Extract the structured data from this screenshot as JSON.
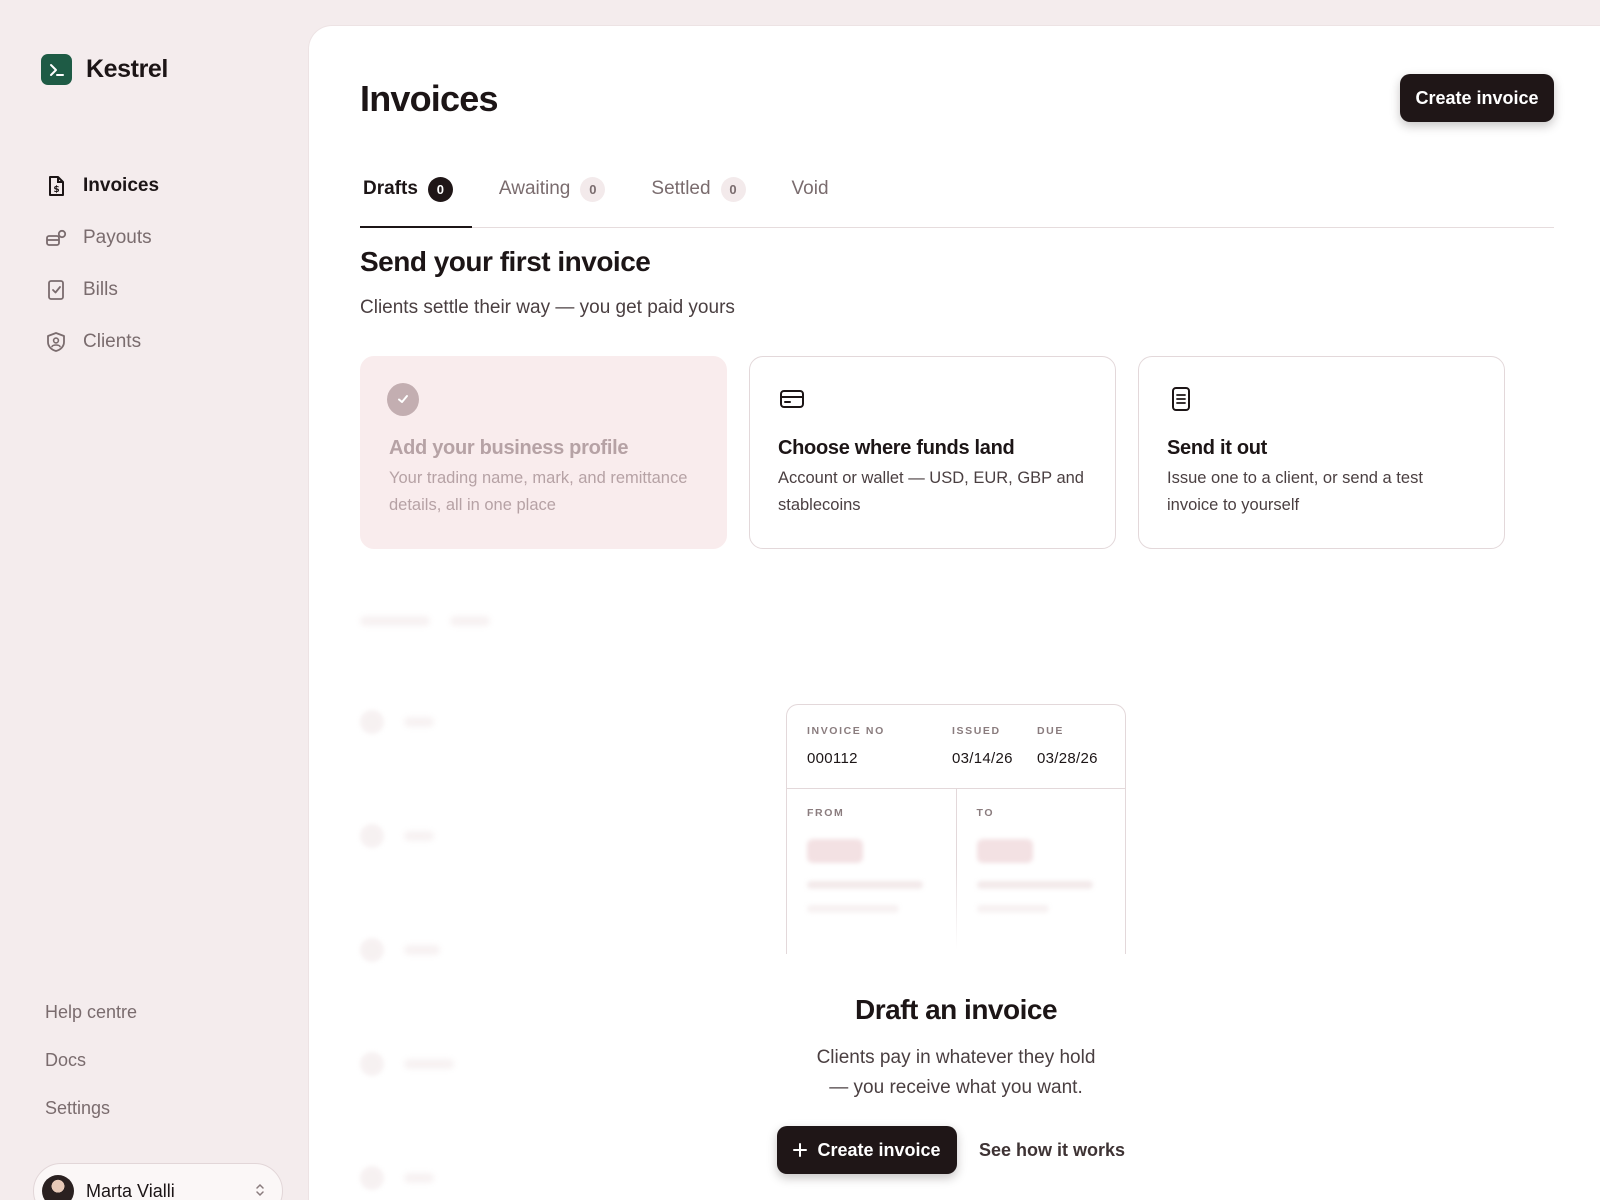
{
  "brand": {
    "name": "Kestrel",
    "logo_icon": "terminal-prompt-icon",
    "color": "#1e5b45"
  },
  "sidebar": {
    "items": [
      {
        "label": "Invoices",
        "icon": "invoice-doc-icon",
        "active": true
      },
      {
        "label": "Payouts",
        "icon": "payouts-icon",
        "active": false
      },
      {
        "label": "Bills",
        "icon": "bill-check-icon",
        "active": false
      },
      {
        "label": "Clients",
        "icon": "shield-user-icon",
        "active": false
      }
    ],
    "footer_links": [
      {
        "label": "Help centre"
      },
      {
        "label": "Docs"
      },
      {
        "label": "Settings"
      }
    ],
    "user": {
      "name": "Marta Vialli"
    }
  },
  "header": {
    "title": "Invoices",
    "create_label": "Create invoice"
  },
  "tabs": [
    {
      "label": "Drafts",
      "count": "0",
      "active": true
    },
    {
      "label": "Awaiting",
      "count": "0",
      "active": false
    },
    {
      "label": "Settled",
      "count": "0",
      "active": false
    },
    {
      "label": "Void",
      "count": null,
      "active": false
    }
  ],
  "onboarding": {
    "title": "Send your first invoice",
    "subtitle": "Clients settle their way — you get paid yours",
    "cards": [
      {
        "title": "Add your business profile",
        "desc": "Your trading name, mark, and remittance details, all in one place",
        "icon": "check-circle-icon",
        "completed": true
      },
      {
        "title": "Choose where funds land",
        "desc": "Account or wallet — USD, EUR, GBP and stablecoins",
        "icon": "wallet-card-icon",
        "completed": false
      },
      {
        "title": "Send it out",
        "desc": "Issue one to a client, or send a test invoice to yourself",
        "icon": "document-lines-icon",
        "completed": false
      }
    ]
  },
  "invoice_preview": {
    "invoice_no_label": "INVOICE NO",
    "invoice_no": "000112",
    "issued_label": "ISSUED",
    "issued": "03/14/26",
    "due_label": "DUE",
    "due": "03/28/26",
    "from_label": "FROM",
    "to_label": "TO"
  },
  "empty_state": {
    "title": "Draft an invoice",
    "line1": "Clients pay in whatever they hold",
    "line2": "— you receive what you want.",
    "create_label": "Create invoice",
    "how_label": "See how it works"
  },
  "colors": {
    "background": "#f4eced",
    "primary_dark": "#1f1617",
    "accent_pink": "#f9eced"
  }
}
